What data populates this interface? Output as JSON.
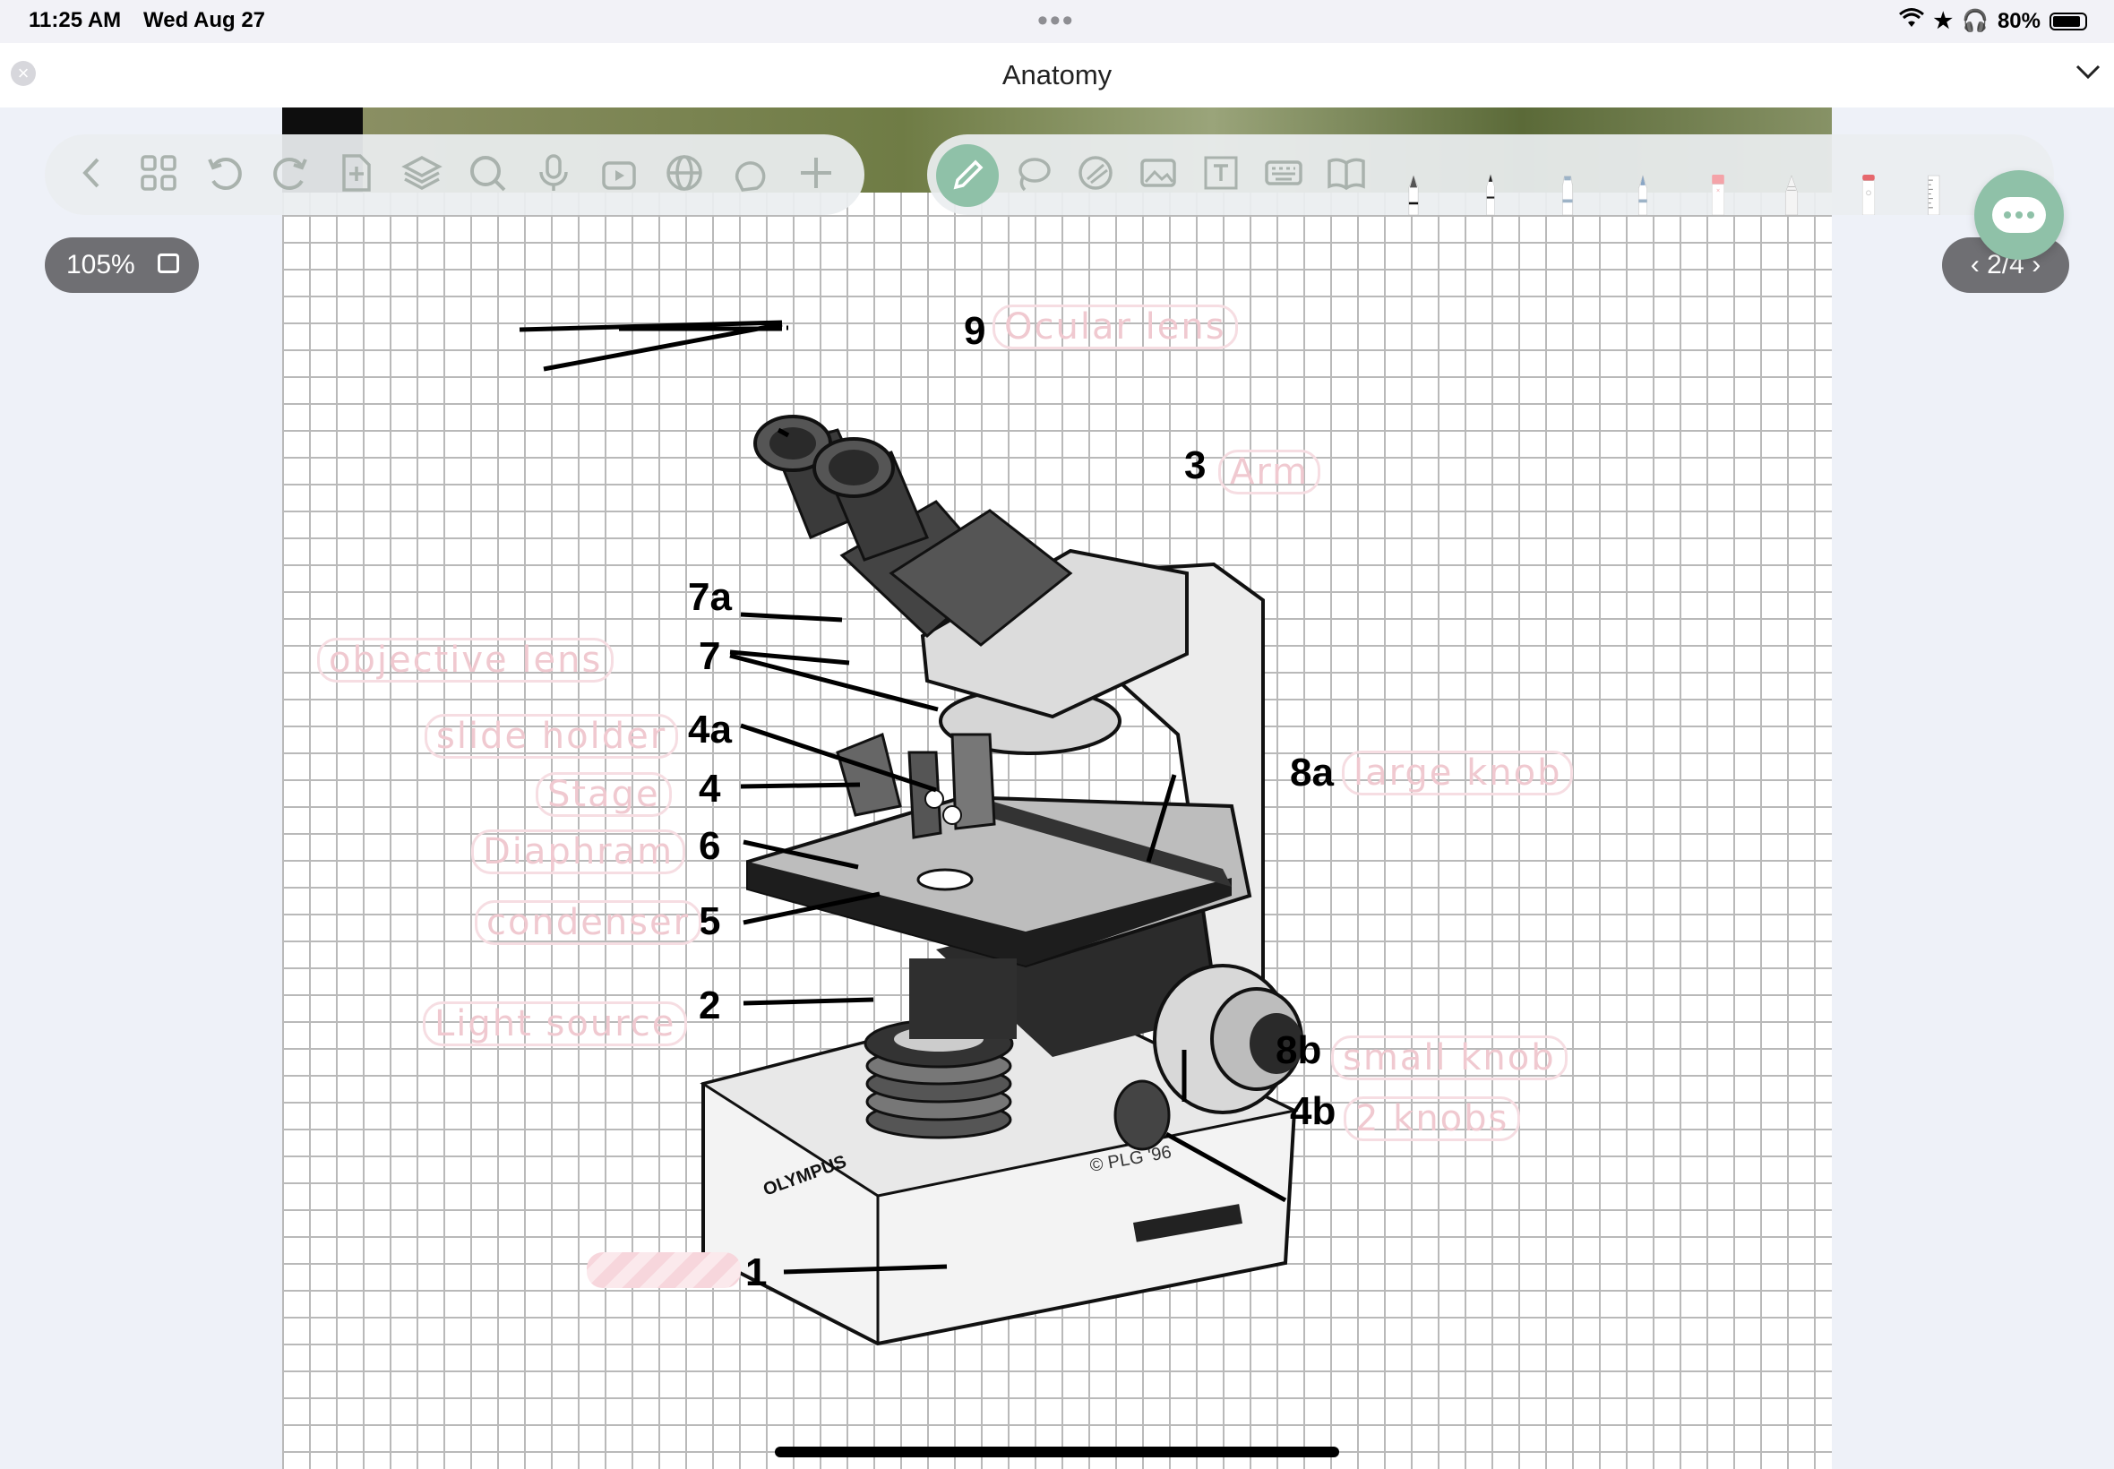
{
  "status_bar": {
    "time": "11:25 AM",
    "date": "Wed Aug 27",
    "battery": "80%"
  },
  "window": {
    "title": "Anatomy"
  },
  "zoom": {
    "label": "105%"
  },
  "pager": {
    "label": "2/4"
  },
  "diagram": {
    "numbers": {
      "n9": "9",
      "n3": "3",
      "n7a": "7a",
      "n7": "7",
      "n4a": "4a",
      "n4": "4",
      "n6": "6",
      "n5": "5",
      "n2": "2",
      "n1": "1",
      "n8a": "8a",
      "n8b": "8b",
      "n4b": "4b"
    },
    "handwritten": {
      "ocular": "Ocular lens",
      "arm": "Arm",
      "objective": "objective lens",
      "slide_holder": "slide holder",
      "stage": "Stage",
      "diaphram": "Diaphram",
      "condenser": "condenser",
      "light_source": "Light source",
      "large_knob": "large knob",
      "small_knob": "small knob",
      "two_knobs": "2 knobs"
    },
    "copyright": "© PLG '96",
    "brand": "OLYMPUS"
  },
  "colors": {
    "accent": "#8fc1a8",
    "handwriting": "#f0c9d0"
  }
}
